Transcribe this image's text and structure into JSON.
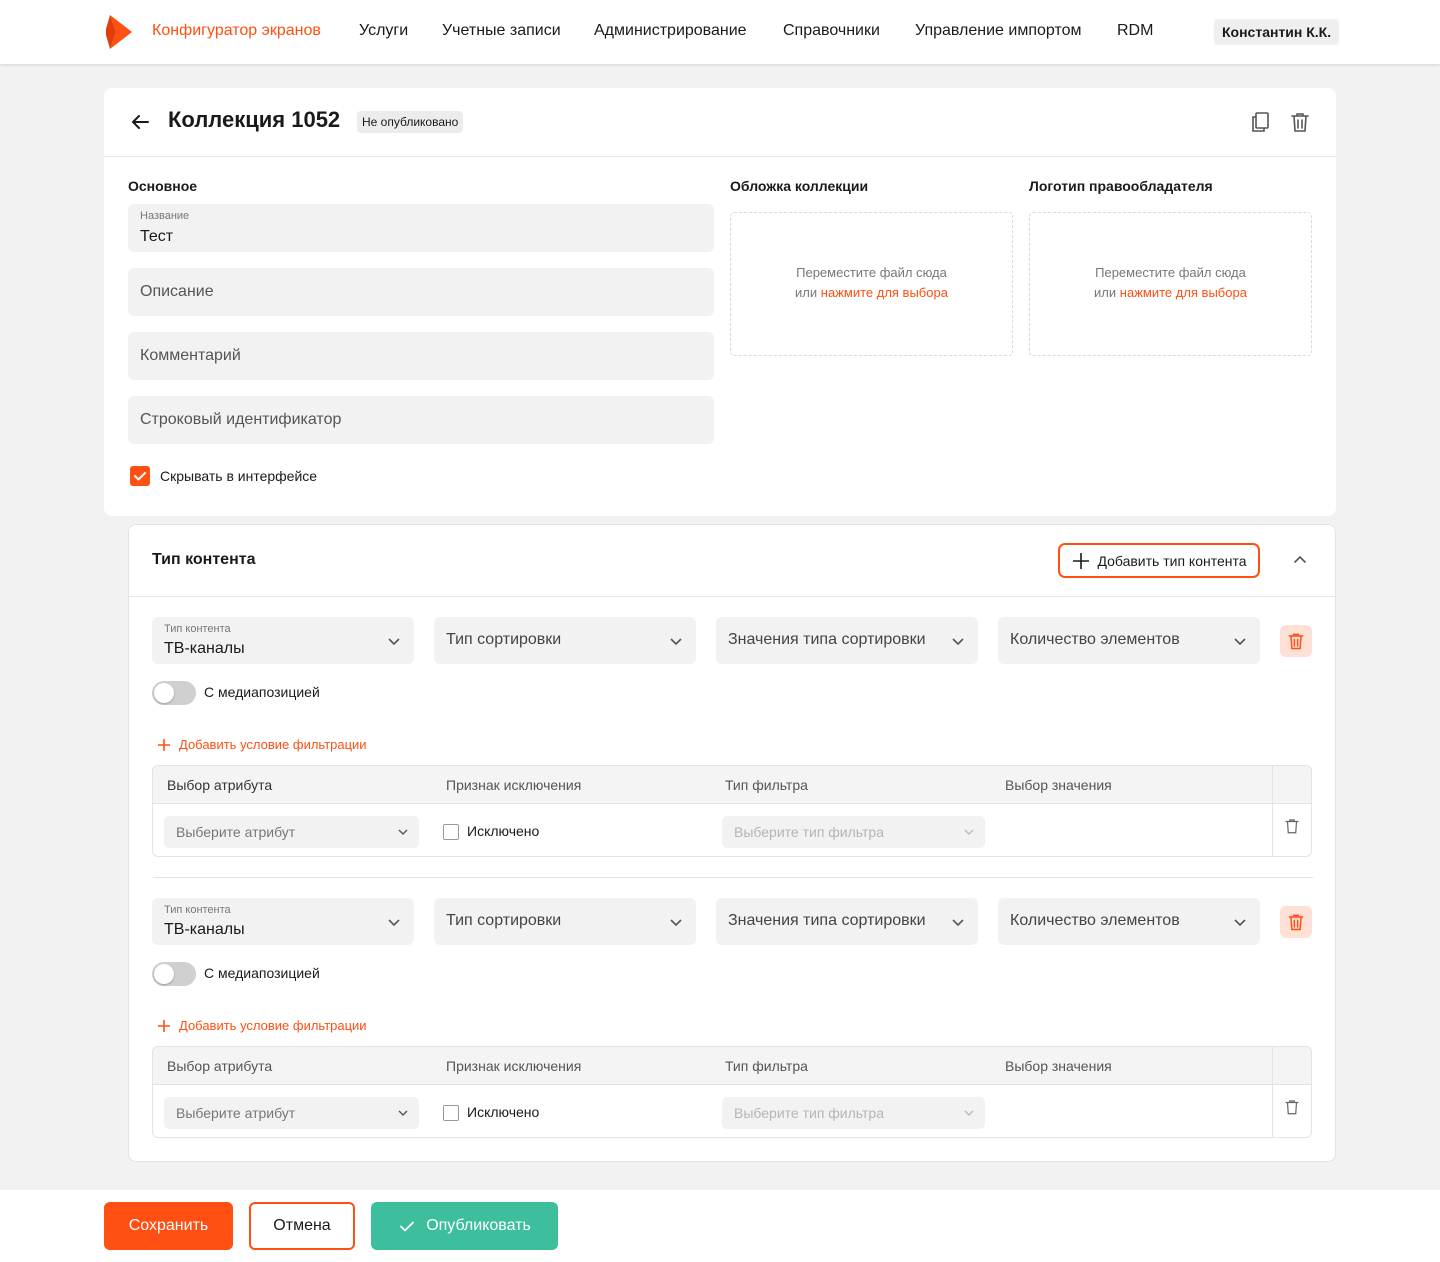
{
  "header": {
    "nav": [
      {
        "label": "Конфигуратор экранов",
        "active": true
      },
      {
        "label": "Услуги"
      },
      {
        "label": "Учетные записи"
      },
      {
        "label": "Администрирование"
      },
      {
        "label": "Справочники"
      },
      {
        "label": "Управление импортом"
      },
      {
        "label": "RDM"
      }
    ],
    "user": "Константин К.К.",
    "accent_color": "#ff4f12"
  },
  "collection": {
    "title": "Коллекция 1052",
    "status": "Не опубликовано",
    "sections": {
      "main": "Основное",
      "cover": "Обложка коллекции",
      "logo": "Логотип правообладателя"
    },
    "fields": {
      "name_label": "Название",
      "name_value": "Тест",
      "description_placeholder": "Описание",
      "comment_placeholder": "Комментарий",
      "string_id_placeholder": "Строковый идентификатор"
    },
    "dropzone": {
      "line1": "Переместите файл сюда",
      "line2_prefix": "или",
      "line2_link": "нажмите для выбора"
    },
    "hide_in_ui": {
      "label": "Скрывать в интерфейсе",
      "checked": true
    }
  },
  "content_type_panel": {
    "title": "Тип контента",
    "add_button": "Добавить тип контента",
    "items": [
      {
        "type_label": "Тип контента",
        "type_value": "ТВ-каналы",
        "sort_type": "Тип сортировки",
        "sort_values": "Значения типа сортировки",
        "count": "Количество элементов",
        "media_position": {
          "label": "С медиапозицией",
          "on": false
        },
        "add_filter": "Добавить условие фильтрации",
        "filter_table": {
          "columns": [
            "Выбор атрибута",
            "Признак исключения",
            "Тип фильтра",
            "Выбор значения"
          ],
          "row": {
            "attribute_placeholder": "Выберите атрибут",
            "excluded_label": "Исключено",
            "filter_type_placeholder": "Выберите тип фильтра"
          }
        }
      },
      {
        "type_label": "Тип контента",
        "type_value": "ТВ-каналы",
        "sort_type": "Тип сортировки",
        "sort_values": "Значения типа сортировки",
        "count": "Количество элементов",
        "media_position": {
          "label": "С медиапозицией",
          "on": false
        },
        "add_filter": "Добавить условие фильтрации",
        "filter_table": {
          "columns": [
            "Выбор атрибута",
            "Признак исключения",
            "Тип фильтра",
            "Выбор значения"
          ],
          "row": {
            "attribute_placeholder": "Выберите атрибут",
            "excluded_label": "Исключено",
            "filter_type_placeholder": "Выберите тип фильтра"
          }
        }
      }
    ]
  },
  "footer": {
    "save": "Сохранить",
    "cancel": "Отмена",
    "publish": "Опубликовать",
    "publish_color": "#3dbf9d"
  }
}
